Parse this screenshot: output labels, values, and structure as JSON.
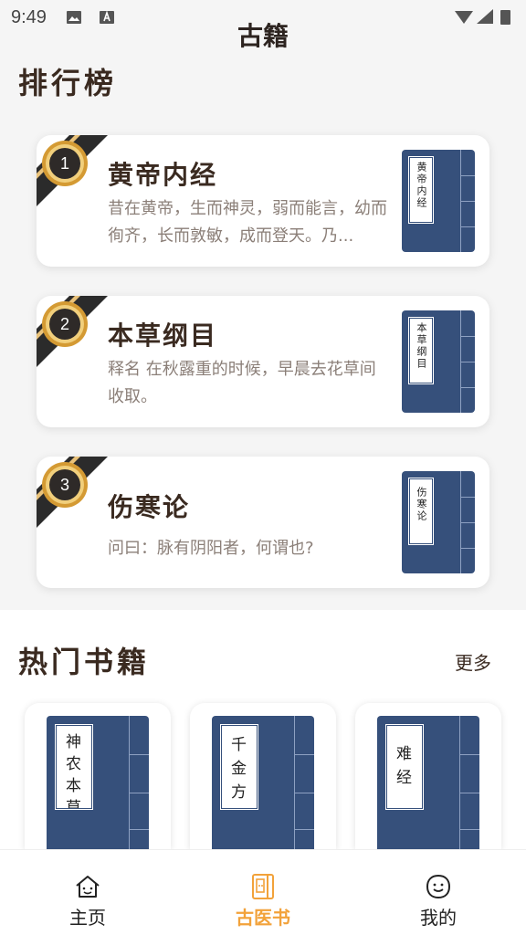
{
  "status": {
    "time": "9:49"
  },
  "app": {
    "title": "古籍"
  },
  "ranking": {
    "title": "排行榜",
    "items": [
      {
        "rank": "1",
        "title": "黄帝内经",
        "desc": "昔在黄帝，生而神灵，弱而能言，幼而徇齐，长而敦敏，成而登天。乃...",
        "cover": "黄帝内经"
      },
      {
        "rank": "2",
        "title": "本草纲目",
        "desc": "释名 在秋露重的时候，早晨去花草间收取。",
        "cover": "本草纲目"
      },
      {
        "rank": "3",
        "title": "伤寒论",
        "desc": "问曰：脉有阴阳者，何谓也?",
        "cover": "伤寒论"
      }
    ]
  },
  "hot": {
    "title": "热门书籍",
    "more": "更多",
    "items": [
      {
        "cover": "神农本草"
      },
      {
        "cover": "千金方"
      },
      {
        "cover": "难经"
      }
    ]
  },
  "nav": {
    "items": [
      {
        "label": "主页",
        "icon": "home-icon"
      },
      {
        "label": "古医书",
        "icon": "book-icon"
      },
      {
        "label": "我的",
        "icon": "smiley-icon"
      }
    ],
    "active_color": "#f2a23a",
    "cover_color": "#36507b"
  }
}
